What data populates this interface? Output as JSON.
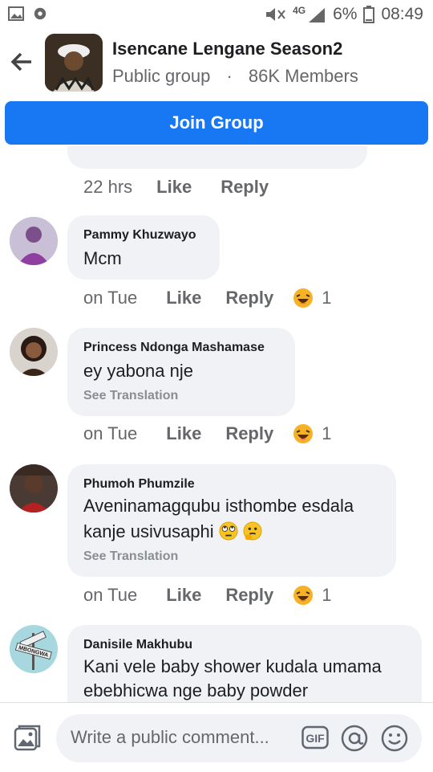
{
  "status_bar": {
    "battery": "6%",
    "time": "08:49",
    "network": "4G"
  },
  "group": {
    "name": "Isencane Lengane Season2",
    "privacy": "Public group",
    "separator": "·",
    "members": "86K Members"
  },
  "join_label": "Join Group",
  "partial_comment": {
    "time": "22 hrs",
    "like": "Like",
    "reply": "Reply"
  },
  "comments": [
    {
      "name": "Pammy Khuzwayo",
      "text": "Mcm",
      "time": "on Tue",
      "like": "Like",
      "reply": "Reply",
      "reaction_count": "1"
    },
    {
      "name": "Princess Ndonga Mashamase",
      "text": "ey yabona nje",
      "translation": "See Translation",
      "time": "on Tue",
      "like": "Like",
      "reply": "Reply",
      "reaction_count": "1"
    },
    {
      "name": "Phumoh Phumzile",
      "text_line1": "Aveninamagqubu isthombe esdala",
      "text_line2": "kanje usivusaphi",
      "translation": "See Translation",
      "time": "on Tue",
      "like": "Like",
      "reply": "Reply",
      "reaction_count": "1"
    },
    {
      "name": "Danisile Makhubu",
      "text_line1": "Kani vele baby shower kudala umama",
      "text_line2": "ebebhicwa nge baby powder",
      "avatar_sign": "MBONGWA"
    }
  ],
  "composer": {
    "placeholder": "Write a public comment...",
    "gif": "GIF"
  },
  "icons": [
    "image-icon",
    "settings-icon",
    "mute-icon",
    "signal-icon",
    "battery-icon",
    "back-arrow-icon",
    "photo-icon",
    "gif-icon",
    "at-icon",
    "emoji-icon",
    "haha-reaction-icon",
    "eyeroll-emoji-icon",
    "thinking-emoji-icon"
  ],
  "colors": {
    "brand": "#1877f2",
    "bubble": "#f0f2f5",
    "secondary_text": "#65676b"
  }
}
